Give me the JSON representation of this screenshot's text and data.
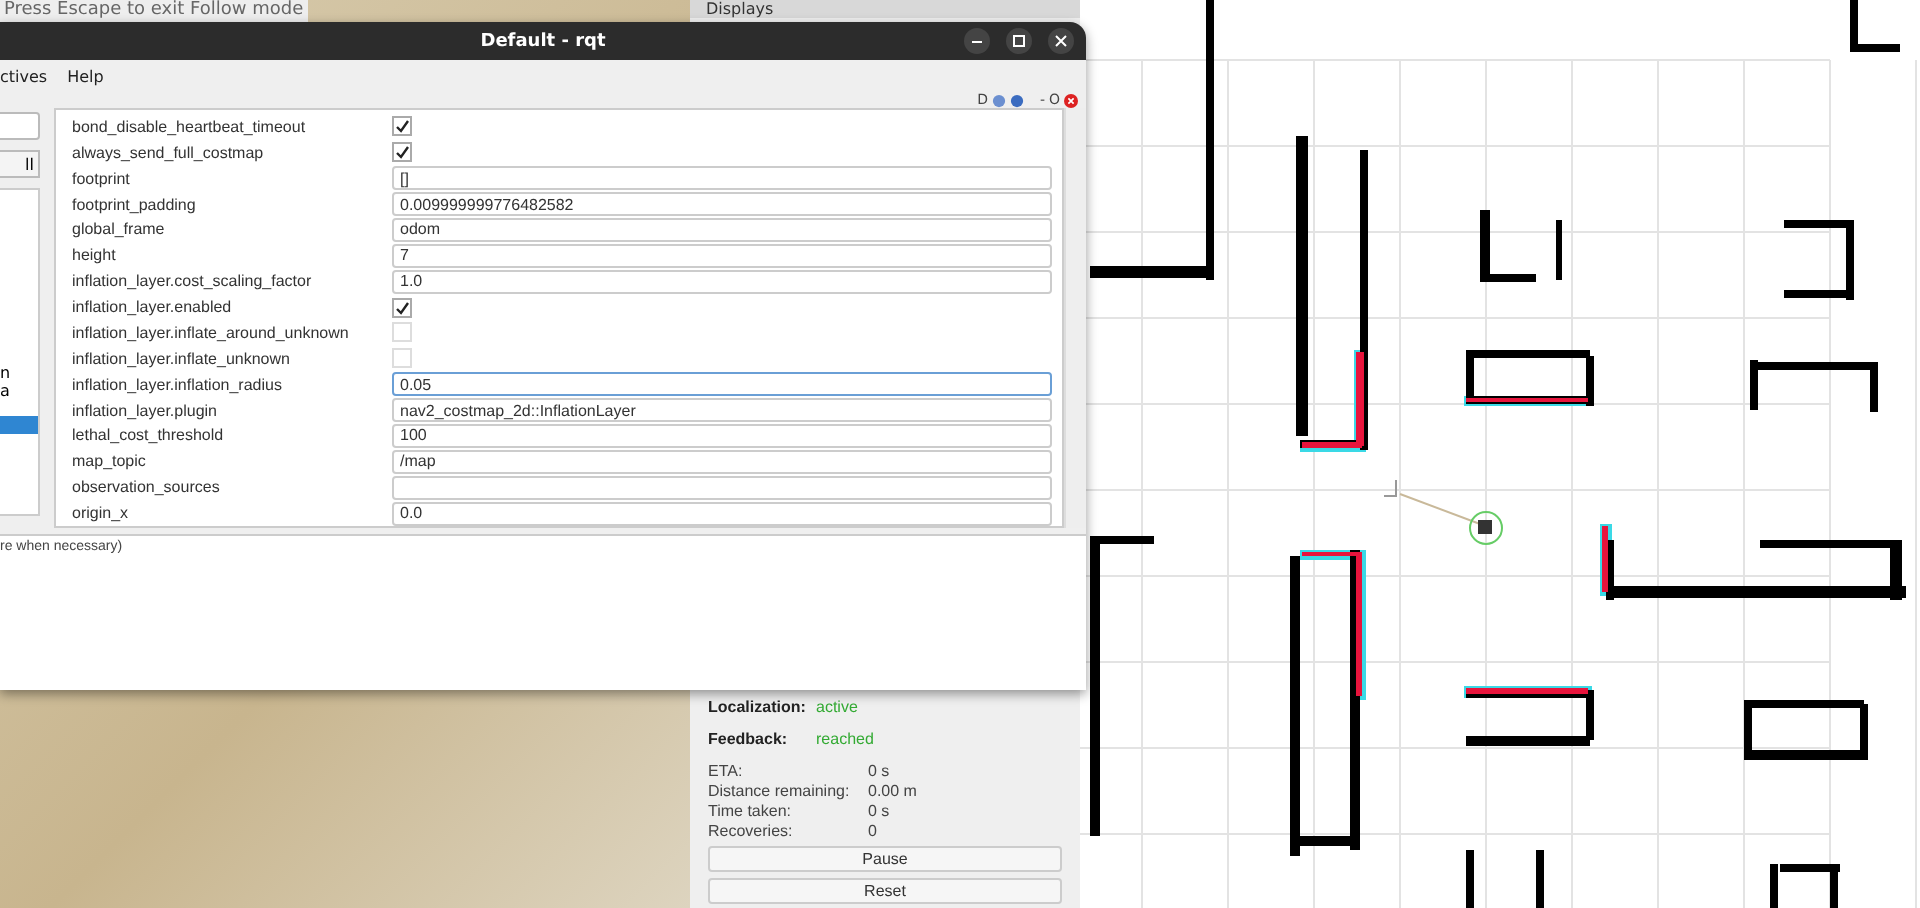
{
  "sim_view": {
    "hint": "Press Escape to exit Follow mode"
  },
  "rviz": {
    "panel_title": "Displays",
    "status": [
      {
        "label": "Localization:",
        "value": "active"
      },
      {
        "label": "Feedback:",
        "value": "reached"
      }
    ],
    "stats": [
      {
        "label": "ETA:",
        "value": "0 s"
      },
      {
        "label": "Distance remaining:",
        "value": "0.00 m"
      },
      {
        "label": "Time taken:",
        "value": "0 s"
      },
      {
        "label": "Recoveries:",
        "value": "0"
      }
    ],
    "buttons": [
      "Pause",
      "Reset"
    ]
  },
  "rqt": {
    "title": "Default - rqt",
    "menu": [
      "ctives",
      "Help"
    ],
    "toolbar": [
      "D",
      "-",
      "O"
    ],
    "left_pane": {
      "button": "ll",
      "items": [
        {
          "label": "n",
          "selected": false
        },
        {
          "label": "a",
          "selected": false
        },
        {
          "selected": true
        }
      ]
    },
    "params": [
      {
        "name": "bond_disable_heartbeat_timeout",
        "kind": "check",
        "checked": true
      },
      {
        "name": "always_send_full_costmap",
        "kind": "check",
        "checked": true
      },
      {
        "name": "footprint",
        "kind": "text",
        "value": "[]",
        "focused": false
      },
      {
        "name": "footprint_padding",
        "kind": "text",
        "value": "0.009999999776482582",
        "focused": false
      },
      {
        "name": "global_frame",
        "kind": "text",
        "value": "odom",
        "focused": false
      },
      {
        "name": "height",
        "kind": "text",
        "value": "7",
        "focused": false
      },
      {
        "name": "inflation_layer.cost_scaling_factor",
        "kind": "text",
        "value": "1.0",
        "focused": false
      },
      {
        "name": "inflation_layer.enabled",
        "kind": "check",
        "checked": true
      },
      {
        "name": "inflation_layer.inflate_around_unknown",
        "kind": "check",
        "checked": false
      },
      {
        "name": "inflation_layer.inflate_unknown",
        "kind": "check",
        "checked": false
      },
      {
        "name": "inflation_layer.inflation_radius",
        "kind": "text",
        "value": "0.05",
        "focused": true
      },
      {
        "name": "inflation_layer.plugin",
        "kind": "text",
        "value": "nav2_costmap_2d::InflationLayer",
        "focused": false
      },
      {
        "name": "lethal_cost_threshold",
        "kind": "text",
        "value": "100",
        "focused": false
      },
      {
        "name": "map_topic",
        "kind": "text",
        "value": "/map",
        "focused": false
      },
      {
        "name": "observation_sources",
        "kind": "text",
        "focused": false
      },
      {
        "name": "origin_x",
        "kind": "text",
        "value": "0.0",
        "focused": false
      }
    ],
    "description": "re when necessary)"
  }
}
